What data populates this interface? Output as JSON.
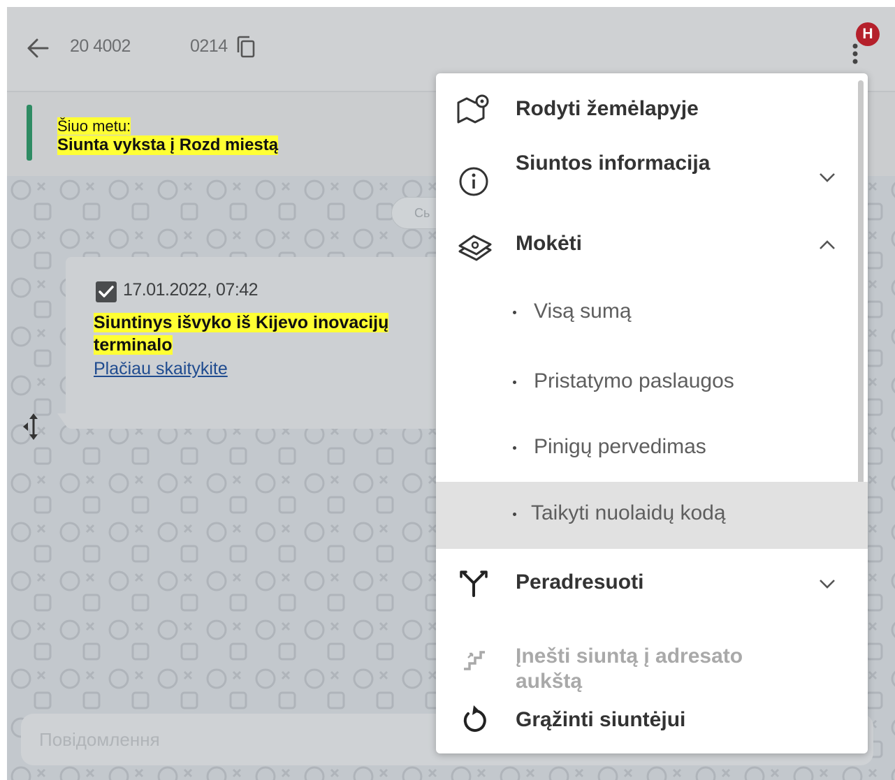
{
  "header": {
    "number_1": "20 4002",
    "number_2": "0214",
    "avatar_initial": "H"
  },
  "status": {
    "label": "Šiuo metu:",
    "value": "Siunta vyksta į Rozd miestą"
  },
  "chip_text": "Сь",
  "message": {
    "date": "17.01.2022, 07:42",
    "text": "Siuntinys išvyko iš Kijevo inovacijų terminalo",
    "link": "Plačiau skaitykite"
  },
  "input_placeholder": "Повідомлення",
  "menu": {
    "items": [
      {
        "label": "Rodyti žemėlapyje",
        "icon": "map-pin-icon"
      },
      {
        "label": "Siuntos informacija",
        "icon": "info-icon",
        "expanded": false
      },
      {
        "label": "Mokėti",
        "icon": "money-icon",
        "expanded": true,
        "children": [
          "Visą sumą",
          "Pristatymo paslaugos",
          "Pinigų pervedimas",
          "Taikyti nuolaidų kodą"
        ]
      },
      {
        "label": "Peradresuoti",
        "icon": "redirect-icon",
        "expanded": false
      },
      {
        "label": "Įnešti siuntą į adresato aukštą",
        "icon": "stairs-icon",
        "disabled": true
      },
      {
        "label": "Grąžinti siuntėjui",
        "icon": "return-icon"
      }
    ],
    "active_child": "Taikyti nuolaidų kodą"
  },
  "colors": {
    "highlight": "#ffff33",
    "accent_green": "#2e8b63",
    "avatar_red": "#b5202b",
    "link_blue": "#1f4b8f"
  }
}
